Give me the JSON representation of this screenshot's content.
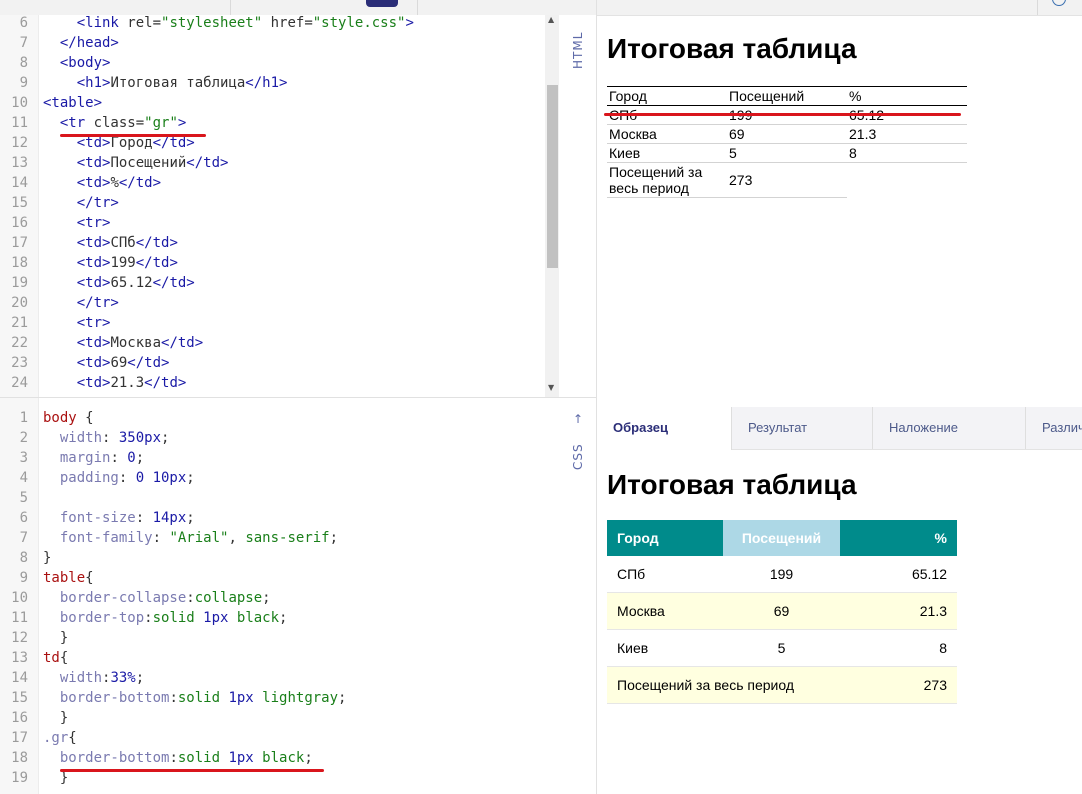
{
  "html_editor": {
    "label": "HTML",
    "lines": [
      {
        "n": "6",
        "parts": [
          [
            "t",
            "    <link "
          ],
          [
            "a",
            "rel="
          ],
          [
            "s",
            "\"stylesheet\""
          ],
          [
            "a",
            " href="
          ],
          [
            "s",
            "\"style.css\""
          ],
          [
            "t",
            ">"
          ]
        ]
      },
      {
        "n": "7",
        "parts": [
          [
            "t",
            "  </head>"
          ]
        ]
      },
      {
        "n": "8",
        "parts": [
          [
            "t",
            "  <body>"
          ]
        ]
      },
      {
        "n": "9",
        "parts": [
          [
            "t",
            "    <h1>"
          ],
          [
            "pc",
            "Итоговая таблица"
          ],
          [
            "t",
            "</h1>"
          ]
        ]
      },
      {
        "n": "10",
        "parts": [
          [
            "t",
            "<table>"
          ]
        ]
      },
      {
        "n": "11",
        "parts": [
          [
            "t",
            "  <tr "
          ],
          [
            "a",
            "class="
          ],
          [
            "s",
            "\"gr\""
          ],
          [
            "t",
            ">"
          ]
        ]
      },
      {
        "n": "12",
        "parts": [
          [
            "t",
            "    <td>"
          ],
          [
            "pc",
            "Город"
          ],
          [
            "t",
            "</td>"
          ]
        ]
      },
      {
        "n": "13",
        "parts": [
          [
            "t",
            "    <td>"
          ],
          [
            "pc",
            "Посещений"
          ],
          [
            "t",
            "</td>"
          ]
        ]
      },
      {
        "n": "14",
        "parts": [
          [
            "t",
            "    <td>"
          ],
          [
            "pc",
            "%"
          ],
          [
            "t",
            "</td>"
          ]
        ]
      },
      {
        "n": "15",
        "parts": [
          [
            "t",
            "    </tr>"
          ]
        ]
      },
      {
        "n": "16",
        "parts": [
          [
            "t",
            "    <tr>"
          ]
        ]
      },
      {
        "n": "17",
        "parts": [
          [
            "t",
            "    <td>"
          ],
          [
            "pc",
            "СПб"
          ],
          [
            "t",
            "</td>"
          ]
        ]
      },
      {
        "n": "18",
        "parts": [
          [
            "t",
            "    <td>"
          ],
          [
            "pc",
            "199"
          ],
          [
            "t",
            "</td>"
          ]
        ]
      },
      {
        "n": "19",
        "parts": [
          [
            "t",
            "    <td>"
          ],
          [
            "pc",
            "65.12"
          ],
          [
            "t",
            "</td>"
          ]
        ]
      },
      {
        "n": "20",
        "parts": [
          [
            "t",
            "    </tr>"
          ]
        ]
      },
      {
        "n": "21",
        "parts": [
          [
            "t",
            "    <tr>"
          ]
        ]
      },
      {
        "n": "22",
        "parts": [
          [
            "t",
            "    <td>"
          ],
          [
            "pc",
            "Москва"
          ],
          [
            "t",
            "</td>"
          ]
        ]
      },
      {
        "n": "23",
        "parts": [
          [
            "t",
            "    <td>"
          ],
          [
            "pc",
            "69"
          ],
          [
            "t",
            "</td>"
          ]
        ]
      },
      {
        "n": "24",
        "parts": [
          [
            "t",
            "    <td>"
          ],
          [
            "pc",
            "21.3"
          ],
          [
            "t",
            "</td>"
          ]
        ]
      }
    ]
  },
  "css_editor": {
    "label": "CSS",
    "lines": [
      {
        "n": "1",
        "parts": [
          [
            "sel",
            "body "
          ],
          [
            "pc",
            "{"
          ]
        ]
      },
      {
        "n": "2",
        "parts": [
          [
            "p",
            "  width"
          ],
          [
            "pc",
            ": "
          ],
          [
            "n",
            "350px"
          ],
          [
            "pc",
            ";"
          ]
        ]
      },
      {
        "n": "3",
        "parts": [
          [
            "p",
            "  margin"
          ],
          [
            "pc",
            ": "
          ],
          [
            "n",
            "0"
          ],
          [
            "pc",
            ";"
          ]
        ]
      },
      {
        "n": "4",
        "parts": [
          [
            "p",
            "  padding"
          ],
          [
            "pc",
            ": "
          ],
          [
            "n",
            "0 10px"
          ],
          [
            "pc",
            ";"
          ]
        ]
      },
      {
        "n": "5",
        "parts": []
      },
      {
        "n": "6",
        "parts": [
          [
            "p",
            "  font-size"
          ],
          [
            "pc",
            ": "
          ],
          [
            "n",
            "14px"
          ],
          [
            "pc",
            ";"
          ]
        ]
      },
      {
        "n": "7",
        "parts": [
          [
            "p",
            "  font-family"
          ],
          [
            "pc",
            ": "
          ],
          [
            "s",
            "\"Arial\""
          ],
          [
            "pc",
            ", "
          ],
          [
            "v",
            "sans-serif"
          ],
          [
            "pc",
            ";"
          ]
        ]
      },
      {
        "n": "8",
        "parts": [
          [
            "pc",
            "}"
          ]
        ]
      },
      {
        "n": "9",
        "parts": [
          [
            "sel",
            "table"
          ],
          [
            "pc",
            "{"
          ]
        ]
      },
      {
        "n": "10",
        "parts": [
          [
            "p",
            "  border-collapse"
          ],
          [
            "pc",
            ":"
          ],
          [
            "v",
            "collapse"
          ],
          [
            "pc",
            ";"
          ]
        ]
      },
      {
        "n": "11",
        "parts": [
          [
            "p",
            "  border-top"
          ],
          [
            "pc",
            ":"
          ],
          [
            "v",
            "solid "
          ],
          [
            "n",
            "1px "
          ],
          [
            "v",
            "black"
          ],
          [
            "pc",
            ";"
          ]
        ]
      },
      {
        "n": "12",
        "parts": [
          [
            "pc",
            "  }"
          ]
        ]
      },
      {
        "n": "13",
        "parts": [
          [
            "sel",
            "td"
          ],
          [
            "pc",
            "{"
          ]
        ]
      },
      {
        "n": "14",
        "parts": [
          [
            "p",
            "  width"
          ],
          [
            "pc",
            ":"
          ],
          [
            "n",
            "33%"
          ],
          [
            "pc",
            ";"
          ]
        ]
      },
      {
        "n": "15",
        "parts": [
          [
            "p",
            "  border-bottom"
          ],
          [
            "pc",
            ":"
          ],
          [
            "v",
            "solid "
          ],
          [
            "n",
            "1px "
          ],
          [
            "v",
            "lightgray"
          ],
          [
            "pc",
            ";"
          ]
        ]
      },
      {
        "n": "16",
        "parts": [
          [
            "pc",
            "  }"
          ]
        ]
      },
      {
        "n": "17",
        "parts": [
          [
            "p",
            ".gr"
          ],
          [
            "pc",
            "{"
          ]
        ]
      },
      {
        "n": "18",
        "parts": [
          [
            "p",
            "  border-bottom"
          ],
          [
            "pc",
            ":"
          ],
          [
            "v",
            "solid "
          ],
          [
            "n",
            "1px "
          ],
          [
            "v",
            "black"
          ],
          [
            "pc",
            ";"
          ]
        ]
      },
      {
        "n": "19",
        "parts": [
          [
            "pc",
            "  }"
          ]
        ]
      }
    ]
  },
  "result": {
    "title": "Итоговая таблица",
    "rows": [
      [
        "Город",
        "Посещений",
        "%"
      ],
      [
        "СПб",
        "199",
        "65.12"
      ],
      [
        "Москва",
        "69",
        "21.3"
      ],
      [
        "Киев",
        "5",
        "8"
      ],
      [
        "Посещений за весь период",
        "273"
      ]
    ]
  },
  "tabs": [
    "Образец",
    "Результат",
    "Наложение",
    "Различ"
  ],
  "sample": {
    "title": "Итоговая таблица",
    "rows": [
      [
        "Город",
        "Посещений",
        "%"
      ],
      [
        "СПб",
        "199",
        "65.12"
      ],
      [
        "Москва",
        "69",
        "21.3"
      ],
      [
        "Киев",
        "5",
        "8"
      ],
      [
        "Посещений за весь период",
        "273"
      ]
    ]
  },
  "colors": {
    "accent": "#2b2e78",
    "header_teal": "#008b8b",
    "header_light": "#add8e6",
    "row_alt": "#ffffe0",
    "annotation_red": "#d9151c"
  }
}
